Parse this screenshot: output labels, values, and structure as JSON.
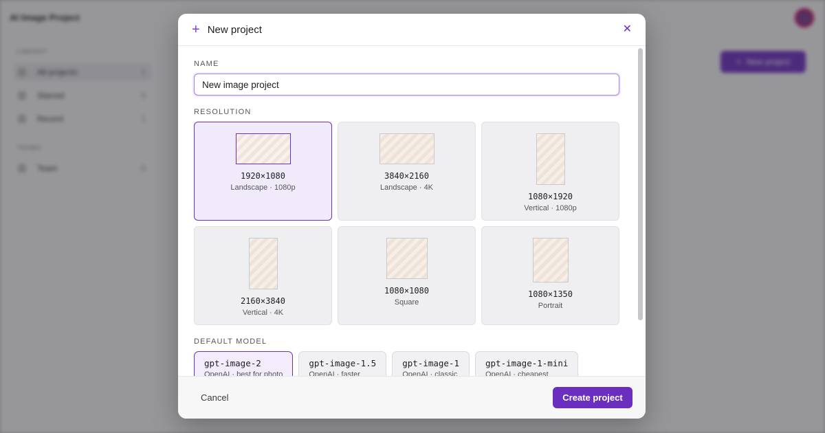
{
  "app": {
    "title": "AI Image Project",
    "library_label": "Library",
    "teams_label": "Teams",
    "nav": [
      {
        "label": "All projects",
        "count": "1"
      },
      {
        "label": "Starred",
        "count": "0"
      },
      {
        "label": "Recent",
        "count": "1"
      }
    ],
    "team_nav": {
      "label": "Team",
      "count": "0"
    },
    "new_project_button": "New project"
  },
  "modal": {
    "title": "New project",
    "plus_icon": "plus-icon",
    "close_icon": "close-icon",
    "name_label": "NAME",
    "name_value": "New image project",
    "resolution_label": "RESOLUTION",
    "resolutions": [
      {
        "value": "1920×1080",
        "sub": "Landscape · 1080p",
        "selected": true
      },
      {
        "value": "3840×2160",
        "sub": "Landscape · 4K",
        "selected": false
      },
      {
        "value": "1080×1920",
        "sub": "Vertical · 1080p",
        "selected": false
      },
      {
        "value": "2160×3840",
        "sub": "Vertical · 4K",
        "selected": false
      },
      {
        "value": "1080×1080",
        "sub": "Square",
        "selected": false
      },
      {
        "value": "1080×1350",
        "sub": "Portrait",
        "selected": false
      }
    ],
    "model_label": "DEFAULT MODEL",
    "models": [
      {
        "name": "gpt-image-2",
        "sub": "OpenAI · best for photo",
        "selected": true
      },
      {
        "name": "gpt-image-1.5",
        "sub": "OpenAI · faster",
        "selected": false
      },
      {
        "name": "gpt-image-1",
        "sub": "OpenAI · classic",
        "selected": false
      },
      {
        "name": "gpt-image-1-mini",
        "sub": "OpenAI · cheapest",
        "selected": false
      }
    ],
    "cancel_label": "Cancel",
    "create_label": "Create project"
  },
  "colors": {
    "accent": "#6b2fbf",
    "selected_bg": "#f1eafb"
  }
}
